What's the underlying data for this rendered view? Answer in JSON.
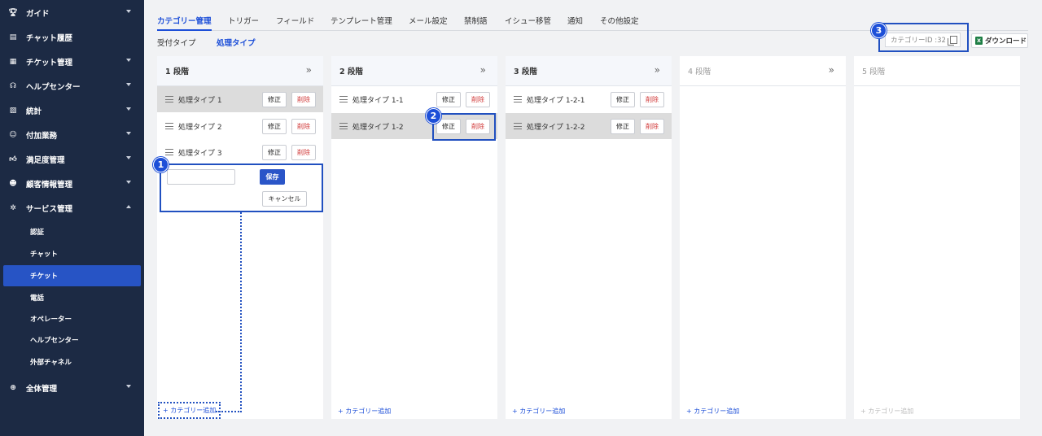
{
  "sidebar": {
    "items": [
      {
        "label": "ガイド",
        "icon": "trophy-icon",
        "caret": "down"
      },
      {
        "label": "チャット履歴",
        "icon": "chat-icon",
        "caret": ""
      },
      {
        "label": "チケット管理",
        "icon": "ticket-icon",
        "caret": "down"
      },
      {
        "label": "ヘルプセンター",
        "icon": "headset-icon",
        "caret": "down"
      },
      {
        "label": "統計",
        "icon": "chart-icon",
        "caret": "down"
      },
      {
        "label": "付加業務",
        "icon": "user-task-icon",
        "caret": "down"
      },
      {
        "label": "満足度管理",
        "icon": "thumbs-up-icon",
        "caret": "down"
      },
      {
        "label": "顧客情報管理",
        "icon": "user-info-icon",
        "caret": "down"
      },
      {
        "label": "サービス管理",
        "icon": "gear-icon",
        "caret": "up"
      }
    ],
    "subitems": [
      "認証",
      "チャット",
      "チケット",
      "電話",
      "オペレーター",
      "ヘルプセンター",
      "外部チャネル"
    ],
    "active_subitem": "チケット",
    "last_item": {
      "label": "全体管理",
      "icon": "plus-circle-icon",
      "caret": "down"
    }
  },
  "tabs": [
    "カテゴリー管理",
    "トリガー",
    "フィールド",
    "テンプレート管理",
    "メール設定",
    "禁制語",
    "イシュー移管",
    "通知",
    "その他設定"
  ],
  "subtabs": [
    "受付タイプ",
    "処理タイプ"
  ],
  "category_id": "カテゴリーID :32",
  "download_label": "ダウンロード",
  "excel_icon_letter": "X",
  "columns": [
    {
      "title": "1 段階",
      "expand": "»",
      "rows": [
        "処理タイプ 1",
        "処理タイプ 2",
        "処理タイプ 3"
      ],
      "add": "+ カテゴリー追加"
    },
    {
      "title": "2 段階",
      "expand": "»",
      "rows": [
        "処理タイプ 1-1",
        "処理タイプ 1-2"
      ],
      "add": "+ カテゴリー追加"
    },
    {
      "title": "3 段階",
      "expand": "»",
      "rows": [
        "処理タイプ 1-2-1",
        "処理タイプ 1-2-2"
      ],
      "add": "+ カテゴリー追加"
    },
    {
      "title": "4 段階",
      "expand": "»",
      "rows": [],
      "add": "+ カテゴリー追加"
    },
    {
      "title": "5 段階",
      "expand": "",
      "rows": [],
      "add": "+ カテゴリー追加"
    }
  ],
  "buttons": {
    "edit": "修正",
    "delete": "削除",
    "save": "保存",
    "cancel": "キャンセル"
  },
  "new_category_input": "",
  "callouts": [
    "1",
    "2",
    "3"
  ],
  "colors": {
    "sidebar": "#1c2a44",
    "accent": "#1d4fd8",
    "active_subitem": "#2754c5",
    "delete_text": "#d03737",
    "selected_row": "#dcdcdc"
  }
}
